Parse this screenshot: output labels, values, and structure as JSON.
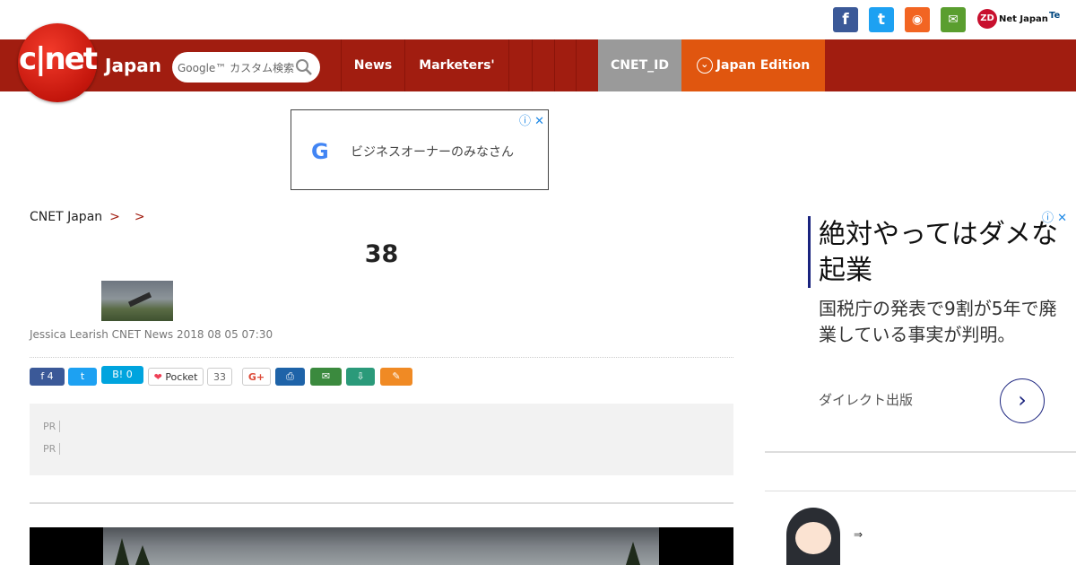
{
  "social": {
    "facebook_glyph": "f",
    "twitter_glyph": "t",
    "rss_glyph": "◉",
    "mail_glyph": "✉",
    "zdnet_logo": "ZD",
    "zdnet_text": "Net Japan",
    "techrepublic_text": "Te"
  },
  "header": {
    "logo_text": "c|net",
    "logo_suffix": "Japan",
    "search_placeholder": "Google™ カスタム検索",
    "nav": [
      {
        "label": "News"
      },
      {
        "label": "Marketers'"
      },
      {
        "label": ""
      },
      {
        "label": ""
      },
      {
        "label": ""
      },
      {
        "label": ""
      }
    ],
    "cnet_id": "CNET_ID",
    "edition": "Japan Edition",
    "edition_glyph": "⌄"
  },
  "top_ad": {
    "google_glyph": "G",
    "text": "ビジネスオーナーのみなさん",
    "adchoice": "ⓘ ✕"
  },
  "breadcrumb": {
    "home": "CNET Japan",
    "sep": ">",
    "level1": "",
    "level2": ""
  },
  "article": {
    "headline": "38",
    "byline": "Jessica Learish CNET News 2018 08 05 07:30",
    "share": {
      "facebook": "f  4",
      "twitter": "t",
      "hatena": "B! 0",
      "pocket_icon": "❤",
      "pocket_label": "Pocket",
      "pocket_count": "33",
      "gplus": "G+",
      "print": "⎙",
      "mail": "✉",
      "download": "⇩",
      "clip": "✎"
    },
    "pr": [
      {
        "tag": "PR",
        "text": ""
      },
      {
        "tag": "PR",
        "text": ""
      }
    ]
  },
  "side_ad": {
    "headline": "絶対やってはダメな起業",
    "body": "国税庁の発表で9割が5年で廃業している事実が判明。",
    "advertiser": "ダイレクト出版",
    "arrow_glyph": "›",
    "adchoice": "ⓘ ✕"
  },
  "sidebar": {
    "section_title": "",
    "item": {
      "title": "",
      "sub1": "⇒",
      "sub2": ""
    }
  },
  "colors": {
    "header_red": "#a11d10",
    "cnet_id_gray": "#9a9a9a",
    "edition_orange": "#e0560f",
    "ad_navy": "#1a237e"
  }
}
